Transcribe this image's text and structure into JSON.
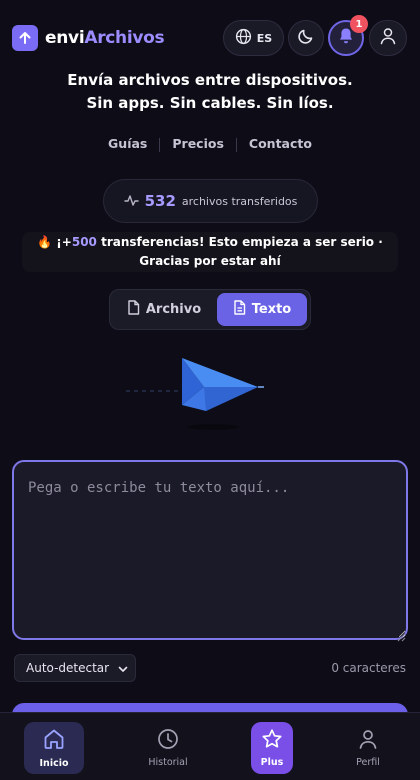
{
  "header": {
    "logo_prefix": "envi",
    "logo_accent": "Archivos",
    "language": "ES",
    "notification_count": "1",
    "icons": [
      "upload-arrow-icon",
      "globe-icon",
      "moon-icon",
      "bell-icon",
      "user-icon"
    ]
  },
  "hero": {
    "line1": "Envía archivos entre dispositivos.",
    "line2": "Sin apps. Sin cables. Sin líos."
  },
  "nav": {
    "guides": "Guías",
    "pricing": "Precios",
    "contact": "Contacto"
  },
  "stats": {
    "count": "532",
    "label": "archivos transferidos"
  },
  "announcement": {
    "prefix": "🔥 ¡+",
    "highlight": "500",
    "text": " transferencias! Esto empieza a ser serio · Gracias por estar ahí"
  },
  "mode": {
    "file_label": "Archivo",
    "text_label": "Texto",
    "selected": "Texto"
  },
  "editor": {
    "placeholder": "Pega o escribe tu texto aquí...",
    "value": "",
    "language_option": "Auto-detectar",
    "char_count": "0 caracteres"
  },
  "bottom_nav": {
    "home": "Inicio",
    "history": "Historial",
    "plus": "Plus",
    "profile": "Perfil",
    "active": "Inicio"
  },
  "colors": {
    "background": "#0e0d17",
    "accent": "#6b63e6",
    "accent_text": "#a69bff",
    "badge": "#f0525f",
    "plus": "#7a4fe8"
  }
}
